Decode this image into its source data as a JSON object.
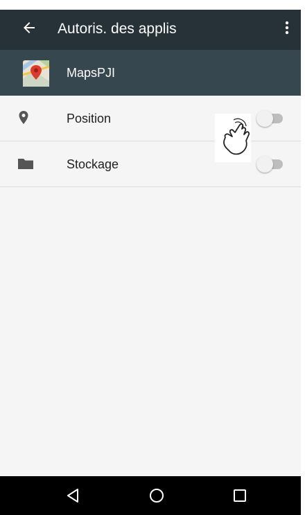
{
  "app_bar": {
    "title": "Autoris. des applis",
    "back_icon": "arrow-left-icon",
    "more_icon": "more-vertical-icon"
  },
  "app_header": {
    "name": "MapsPJI",
    "icon": "maps-app-icon"
  },
  "permissions": [
    {
      "label": "Position",
      "icon": "location-pin-icon",
      "enabled": false
    },
    {
      "label": "Stockage",
      "icon": "folder-icon",
      "enabled": false
    }
  ],
  "overlay": {
    "icon": "tap-hand-icon"
  },
  "nav_bar": {
    "buttons": [
      "back-triangle-icon",
      "home-circle-icon",
      "recents-square-icon"
    ]
  },
  "colors": {
    "app_bar": "#263238",
    "app_header": "#37474f",
    "background": "#f5f5f5",
    "nav_bar": "#000000"
  }
}
